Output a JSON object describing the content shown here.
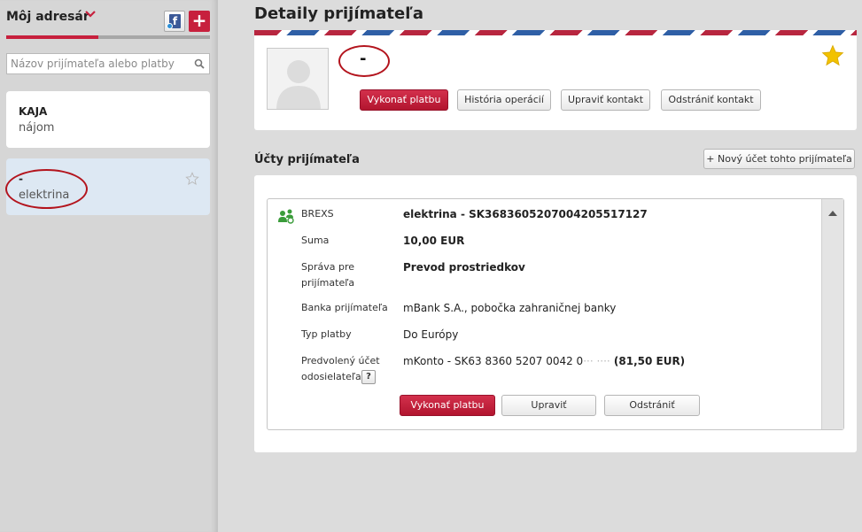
{
  "sidebar": {
    "title": "Môj adresár",
    "progress_fraction": 0.45,
    "search_placeholder": "Názov prijímateľa alebo platby",
    "contacts": [
      {
        "name": "KAJA",
        "subtitle": "nájom"
      },
      {
        "name": "-",
        "subtitle": "elektrina"
      }
    ],
    "add_label": "+"
  },
  "details": {
    "title": "Detaily prijímateľa",
    "contact_name": "-",
    "buttons": {
      "pay": "Vykonať platbu",
      "history": "História operácií",
      "edit": "Upraviť kontakt",
      "delete": "Odstrániť kontakt"
    }
  },
  "accounts": {
    "title": "Účty prijímateľa",
    "new_account_button": "+ Nový účet tohto prijímateľa",
    "account": {
      "bank_code": "BREXS",
      "name_and_iban": "elektrina  - SK3683605207004205517127",
      "rows": [
        {
          "label": "Suma",
          "value": "10,00 EUR"
        },
        {
          "label": "Správa pre prijímateľa",
          "value": "Prevod prostriedkov"
        },
        {
          "label": "Banka prijímateľa",
          "value": "mBank S.A., pobočka zahraničnej banky"
        },
        {
          "label": "Typ platby",
          "value": "Do Európy"
        },
        {
          "label": "Predvolený účet odosielateľa",
          "value_prefix": "mKonto - SK63 8360 5207 0042 0",
          "value_masked": "··· ····",
          "value_suffix": " (81,50 EUR)"
        }
      ],
      "help_label": "?",
      "buttons": {
        "pay": "Vykonať platbu",
        "edit": "Upraviť",
        "delete": "Odstrániť"
      }
    }
  },
  "colors": {
    "accent": "#c7203d",
    "selected_bg": "#dde8f3",
    "annotation": "#b3141d",
    "star": "#f2c200"
  }
}
